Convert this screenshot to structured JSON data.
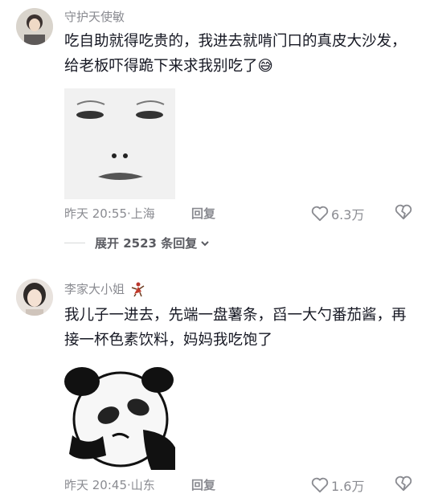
{
  "comments": [
    {
      "username": "守护天使敏",
      "text": "吃自助就得吃贵的，我进去就啃门口的真皮大沙发，给老板吓得跪下来求我别吃了",
      "emoji": "😅",
      "time": "昨天 20:55",
      "location": "上海",
      "reply_label": "回复",
      "likes": "6.3万",
      "expand_label": "展开 2523 条回复"
    },
    {
      "username": "李家大小姐",
      "text": "我儿子一进去，先端一盘薯条，舀一大勺番茄酱，再接一杯色素饮料，妈妈我吃饱了",
      "time": "昨天 20:45",
      "location": "山东",
      "reply_label": "回复",
      "likes": "1.6万"
    }
  ],
  "colors": {
    "text": "#161823",
    "meta": "#8a8b91"
  }
}
